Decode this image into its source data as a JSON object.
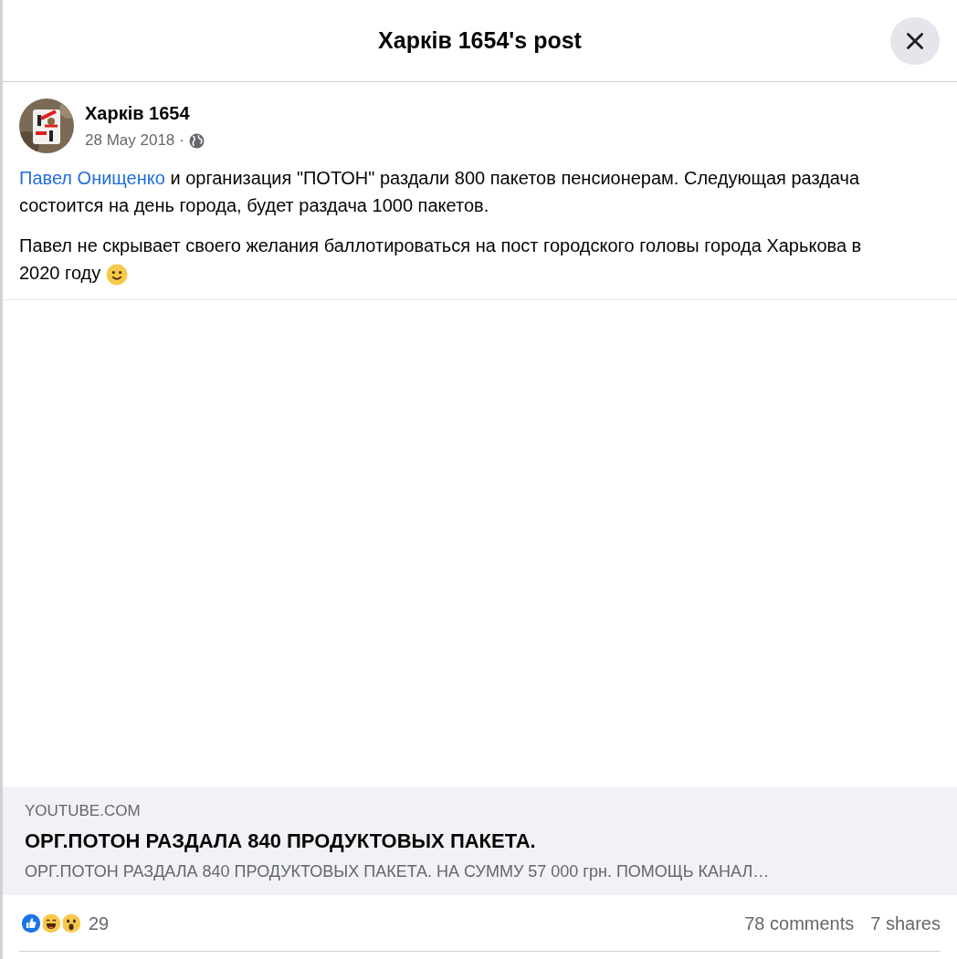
{
  "dialog": {
    "title": "Харків 1654's post"
  },
  "post": {
    "author": "Харків 1654",
    "date": "28 May 2018",
    "separator": "·",
    "paragraphs": [
      {
        "link": "Павел Онищенко",
        "text": " и организация \"ПОТОН\" раздали 800 пакетов пенсионерам. Следующая раздача состоится на день города, будет раздача 1000 пакетов."
      },
      {
        "text": "Павел не скрывает своего желания баллотироваться на пост городского головы города Харькова в 2020 году",
        "emoji": true
      }
    ]
  },
  "link_preview": {
    "domain": "YOUTUBE.COM",
    "title": "ОРГ.ПОТОН РАЗДАЛА 840 ПРОДУКТОВЫХ ПАКЕТА.",
    "description": "ОРГ.ПОТОН РАЗДАЛА 840 ПРОДУКТОВЫХ ПАКЕТА. НА СУММУ 57 000 грн. ПОМОЩЬ КАНАЛ…"
  },
  "reactions": [
    {
      "kind": "like"
    },
    {
      "kind": "haha"
    },
    {
      "kind": "wow"
    }
  ],
  "reaction_count": "29",
  "comments": "78 comments",
  "shares": "7 shares"
}
